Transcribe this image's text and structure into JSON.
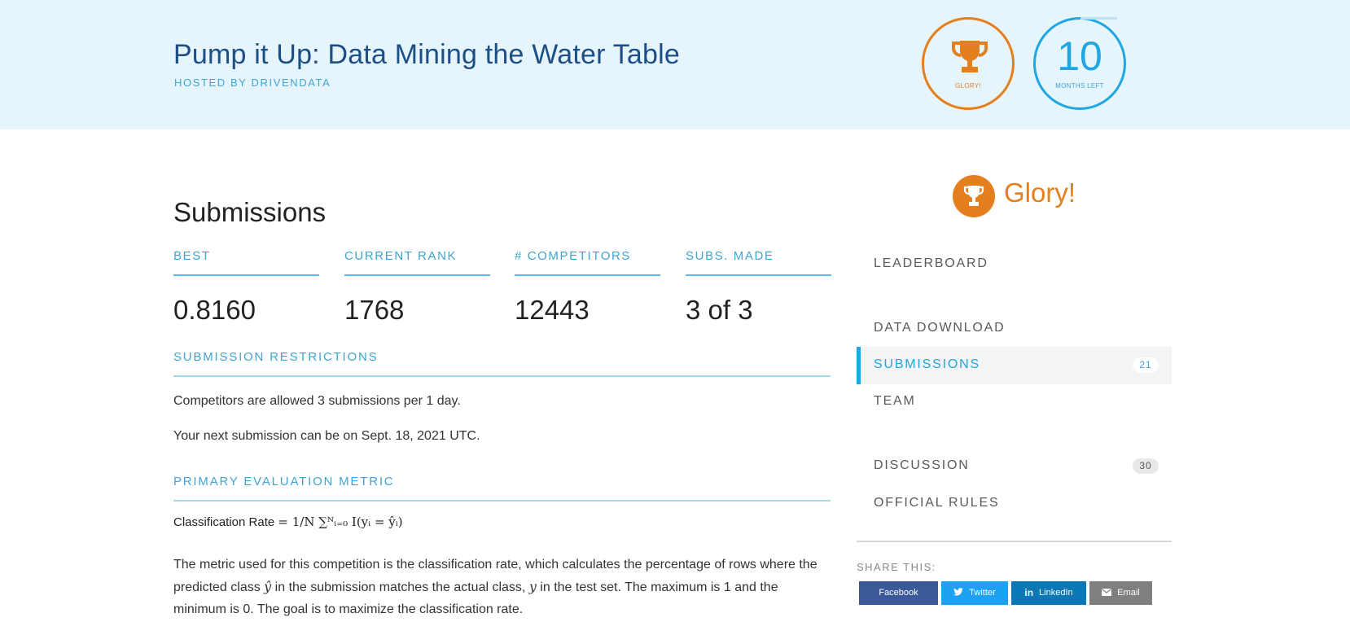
{
  "header": {
    "title": "Pump it Up: Data Mining the Water Table",
    "host": "HOSTED BY DRIVENDATA",
    "prize_label": "GLORY!",
    "time_number": "10",
    "time_label": "MONTHS LEFT"
  },
  "main": {
    "title": "Submissions",
    "stats": [
      {
        "label": "BEST",
        "value": "0.8160"
      },
      {
        "label": "CURRENT RANK",
        "value": "1768"
      },
      {
        "label": "# COMPETITORS",
        "value": "12443"
      },
      {
        "label": "SUBS. MADE",
        "value": "3 of 3"
      }
    ],
    "restrictions_heading": "SUBMISSION RESTRICTIONS",
    "restrictions_line1": "Competitors are allowed 3 submissions per 1 day.",
    "restrictions_line2": "Your next submission can be on Sept. 18, 2021 UTC.",
    "metric_heading": "PRIMARY EVALUATION METRIC",
    "formula_label": "Classification Rate",
    "formula_math": "= 1/N ∑ᴺᵢ₌₀ I(yᵢ = ŷᵢ)",
    "paragraph_part1": "The metric used for this competition is the classification rate, which calculates the percentage of rows where the predicted class ",
    "paragraph_math1": "ŷ",
    "paragraph_part2": " in the submission matches the actual class, ",
    "paragraph_math2": "y",
    "paragraph_part3": " in the test set. The maximum is 1 and the minimum is 0. The goal is to maximize the classification rate."
  },
  "sidebar": {
    "prize_text": "Glory!",
    "nav": [
      {
        "label": "LEADERBOARD"
      },
      {
        "label": "DATA DOWNLOAD"
      },
      {
        "label": "SUBMISSIONS",
        "count": "21",
        "active": true
      },
      {
        "label": "TEAM"
      },
      {
        "label": "DISCUSSION",
        "count": "30"
      },
      {
        "label": "OFFICIAL RULES"
      }
    ],
    "share_label": "SHARE THIS:",
    "share_buttons": [
      {
        "label": "Facebook",
        "icon": "facebook-icon",
        "color": "#3b5998"
      },
      {
        "label": "Twitter",
        "icon": "twitter-icon",
        "color": "#1da1f2"
      },
      {
        "label": "LinkedIn",
        "icon": "linkedin-icon",
        "color": "#0a78b5"
      },
      {
        "label": "Email",
        "icon": "email-icon",
        "color": "#7f7f7f"
      }
    ]
  },
  "colors": {
    "banner_bg": "#e6f5fc",
    "title_blue": "#1b4f86",
    "accent_blue": "#20a6e0",
    "label_blue": "#3fa4d4",
    "prize_orange": "#e37f1d"
  }
}
